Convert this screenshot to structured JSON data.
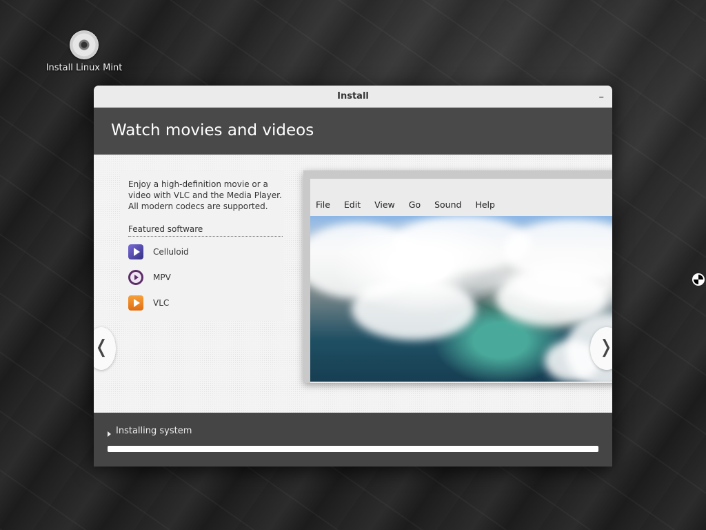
{
  "desktop": {
    "icon_label": "Install Linux Mint"
  },
  "window": {
    "title": "Install",
    "minimize_symbol": "–"
  },
  "slide": {
    "heading": "Watch movies and videos",
    "description": "Enjoy a high-definition movie or a video with VLC and the Media Player. All modern codecs are supported.",
    "featured_title": "Featured software",
    "software": [
      {
        "name": "Celluloid",
        "icon": "celluloid-icon"
      },
      {
        "name": "MPV",
        "icon": "mpv-icon"
      },
      {
        "name": "VLC",
        "icon": "vlc-icon"
      }
    ],
    "player_menu": [
      "File",
      "Edit",
      "View",
      "Go",
      "Sound",
      "Help"
    ],
    "prev_symbol": "❬",
    "next_symbol": "❭"
  },
  "footer": {
    "status": "Installing system",
    "progress": 0
  },
  "colors": {
    "header_bg": "#494949",
    "footer_bg": "#454545",
    "titlebar_bg": "#ebebeb"
  }
}
